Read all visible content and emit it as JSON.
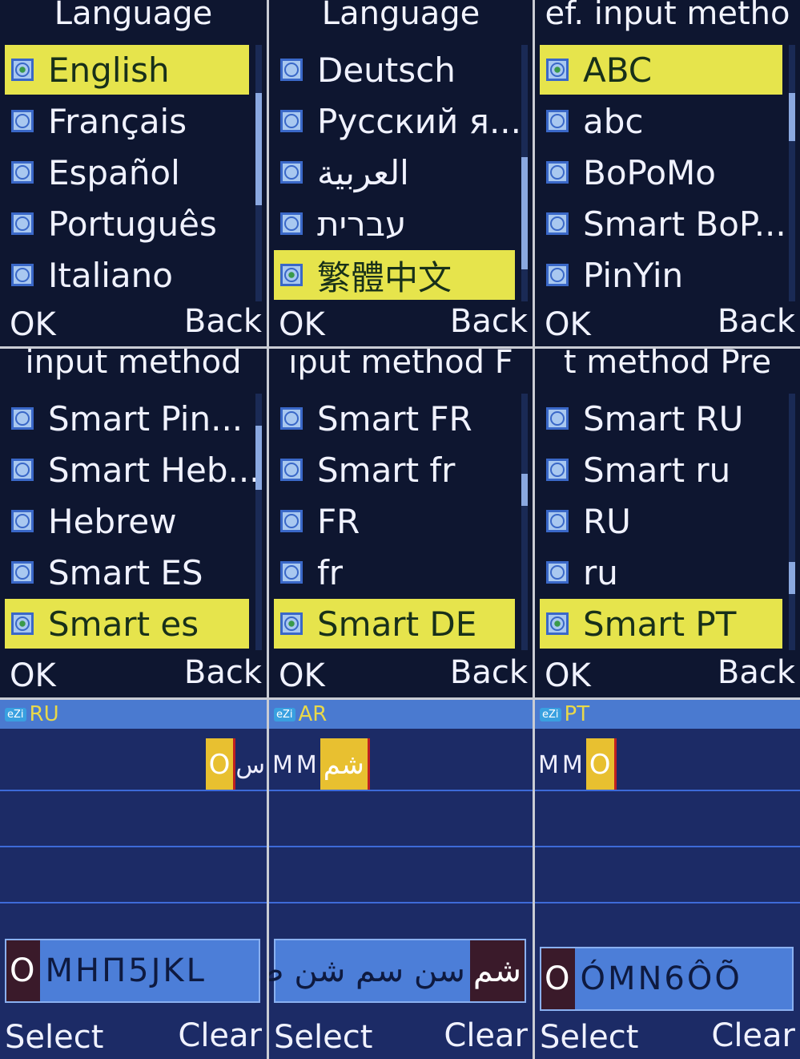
{
  "list_panels": [
    {
      "title": "Language",
      "selected": 0,
      "items": [
        "English",
        "Français",
        "Español",
        "Português",
        "Italiano"
      ],
      "ok": "OK",
      "back": "Back"
    },
    {
      "title": "Language",
      "selected": 4,
      "items": [
        "Deutsch",
        "Русский я...",
        "العربية",
        "עברית",
        "繁體中文"
      ],
      "ok": "OK",
      "back": "Back"
    },
    {
      "title": "ef. input metho",
      "selected": 0,
      "items": [
        "ABC",
        "abc",
        "BoPoMo",
        "Smart BoP...",
        "PinYin"
      ],
      "ok": "OK",
      "back": "Back"
    },
    {
      "title": "input method",
      "selected": 4,
      "items": [
        "Smart Pin...",
        "Smart Heb...",
        "Hebrew",
        "Smart ES",
        "Smart es"
      ],
      "ok": "OK",
      "back": "Back"
    },
    {
      "title": "ıput method    F",
      "selected": 4,
      "items": [
        "Smart FR",
        "Smart fr",
        "FR",
        "fr",
        "Smart DE"
      ],
      "ok": "OK",
      "back": "Back"
    },
    {
      "title": "t method    Pre",
      "selected": 4,
      "items": [
        "Smart RU",
        "Smart ru",
        "RU",
        "ru",
        "Smart PT"
      ],
      "ok": "OK",
      "back": "Back"
    }
  ],
  "input_panels": [
    {
      "badge": "eZi",
      "mode": "RU",
      "typed": "",
      "current": "O",
      "after": "س",
      "candidates_first": "O",
      "candidates": "MHП5JKL",
      "select": "Select",
      "clear": "Clear"
    },
    {
      "badge": "eZi",
      "mode": "AR",
      "typed": "MM",
      "current": "شم",
      "after": "",
      "candidates_first": "شم",
      "candidates": "سن سم شن صم",
      "select": "Select",
      "clear": "Clear"
    },
    {
      "badge": "eZi",
      "mode": "PT",
      "typed": "MM",
      "current": "O",
      "after": "",
      "candidates_first": "O",
      "candidates": "ÓMN6ÔÕ",
      "select": "Select",
      "clear": "Clear"
    }
  ],
  "colors": {
    "highlight": "#e6e44c",
    "background": "#0e1630",
    "input_background": "#1c2b66",
    "mode_text": "#e8d84a"
  }
}
